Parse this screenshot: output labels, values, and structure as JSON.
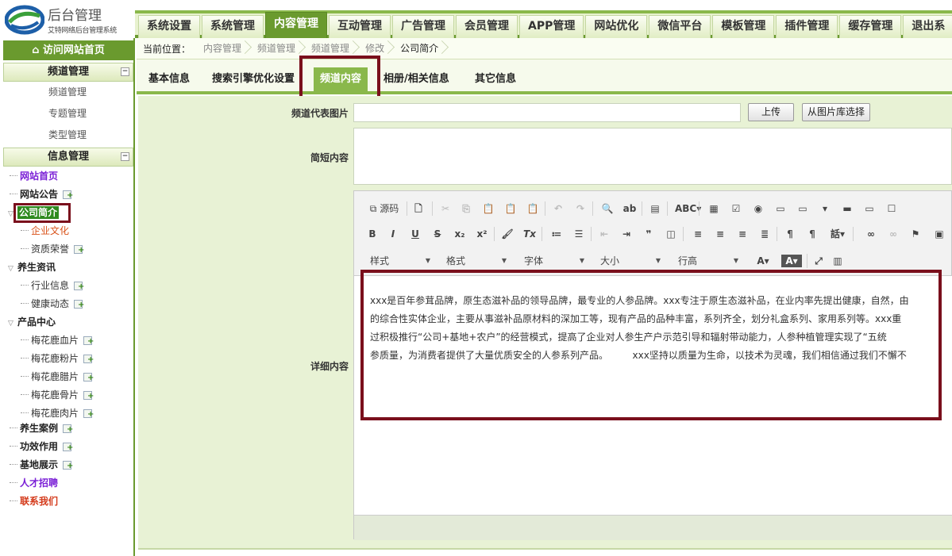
{
  "logo": {
    "title": "后台管理",
    "subtitle": "艾特网络后台管理系统"
  },
  "topnav": [
    "系统设置",
    "系统管理",
    "内容管理",
    "互动管理",
    "广告管理",
    "会员管理",
    "APP管理",
    "网站优化",
    "微信平台",
    "模板管理",
    "插件管理",
    "缓存管理",
    "退出系"
  ],
  "topnav_active": "内容管理",
  "sidebar": {
    "home": "访问网站首页",
    "group1": {
      "title": "频道管理",
      "toggle": "−",
      "items": [
        "频道管理",
        "专题管理",
        "类型管理"
      ]
    },
    "group2": {
      "title": "信息管理",
      "toggle": "−"
    },
    "tree": [
      {
        "label": "网站首页"
      },
      {
        "label": "网站公告"
      },
      {
        "label": "公司简介"
      },
      {
        "label": "企业文化"
      },
      {
        "label": "资质荣誉"
      },
      {
        "label": "养生资讯"
      },
      {
        "label": "行业信息"
      },
      {
        "label": "健康动态"
      },
      {
        "label": "产品中心"
      },
      {
        "label": "梅花鹿血片"
      },
      {
        "label": "梅花鹿粉片"
      },
      {
        "label": "梅花鹿腊片"
      },
      {
        "label": "梅花鹿骨片"
      },
      {
        "label": "梅花鹿肉片"
      },
      {
        "label": "养生案例"
      },
      {
        "label": "功效作用"
      },
      {
        "label": "基地展示"
      },
      {
        "label": "人才招聘"
      },
      {
        "label": "联系我们"
      }
    ]
  },
  "breadcrumb": {
    "lead": "当前位置：",
    "items": [
      "内容管理",
      "频道管理",
      "频道管理",
      "修改",
      "公司简介"
    ]
  },
  "subtabs": [
    "基本信息",
    "搜索引擎优化设置",
    "频道内容",
    "相册/相关信息",
    "其它信息"
  ],
  "subtab_active": "频道内容",
  "form": {
    "image_label": "频道代表图片",
    "image_value": "",
    "upload_btn": "上传",
    "gallery_btn": "从图片库选择",
    "summary_label": "简短内容",
    "summary_value": "",
    "detail_label": "详细内容"
  },
  "editor": {
    "source_label": "源码",
    "combos": [
      "样式",
      "格式",
      "字体",
      "大小",
      "行高"
    ],
    "content_lines": [
      "xxx是百年参茸品牌，原生态滋补品的领导品牌，最专业的人参品牌。xxx专注于原生态滋补品，在业内率先提出健康，自然，由",
      "的综合性实体企业，主要从事滋补品原材料的深加工等，现有产品的品种丰富，系列齐全，划分礼盒系列、家用系列等。xxx重",
      "过积极推行“公司+基地+农户”的经营模式，提高了企业对人参生产户示范引导和辐射带动能力，人参种植管理实现了“五统",
      "参质量，为消费者提供了大量优质安全的人参系列产品。        xxx坚持以质量为生命，以技术为灵魂，我们相信通过我们不懈不"
    ]
  },
  "colors": {
    "brand_green": "#6a9a2e",
    "accent_green": "#8ab84b",
    "highlight_box": "#7a0f1c"
  }
}
